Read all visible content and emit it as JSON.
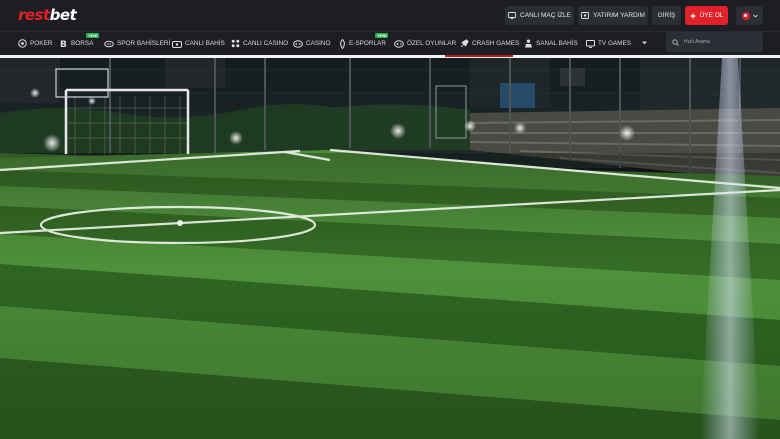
{
  "brand": {
    "logo_part1": "rest",
    "logo_part2": "bet"
  },
  "header": {
    "buttons": [
      {
        "label": "CANLI MAÇ İZLE",
        "icon": "tv-icon"
      },
      {
        "label": "YATIRIM YARDIM",
        "icon": "money-icon"
      },
      {
        "label": "GİRİŞ"
      },
      {
        "label": "ÜYE OL",
        "icon": "plus-icon",
        "accent": "#e2202a"
      }
    ],
    "language_flag": "turkey-flag-icon"
  },
  "nav": {
    "items": [
      {
        "label": "POKER",
        "icon": "poker-chip-icon"
      },
      {
        "label": "BORSA",
        "icon": "bitcoin-icon",
        "badge": "YENİ"
      },
      {
        "label": "SPOR BAHİSLERİ",
        "icon": "football-icon"
      },
      {
        "label": "CANLI BAHİS",
        "icon": "live-icon"
      },
      {
        "label": "CANLI CASINO",
        "icon": "cards-icon"
      },
      {
        "label": "CASINO",
        "icon": "slot-icon"
      },
      {
        "label": "E-SPORLAR",
        "icon": "gamepad-icon",
        "badge": "YENİ"
      },
      {
        "label": "ÖZEL OYUNLAR",
        "icon": "joystick-icon"
      },
      {
        "label": "CRASH GAMES",
        "icon": "rocket-icon"
      },
      {
        "label": "SANAL BAHİS",
        "icon": "virtual-icon"
      },
      {
        "label": "TV GAMES",
        "icon": "tv-icon"
      }
    ],
    "more_icon": "chevron-down-icon"
  },
  "search": {
    "placeholder": "Hızlı Arama"
  },
  "colors": {
    "accent": "#e2202a",
    "background": "#1c1e24",
    "button": "#2b2e35",
    "badge": "#21b24b"
  },
  "hero": {
    "image": "night football pitch photo"
  }
}
